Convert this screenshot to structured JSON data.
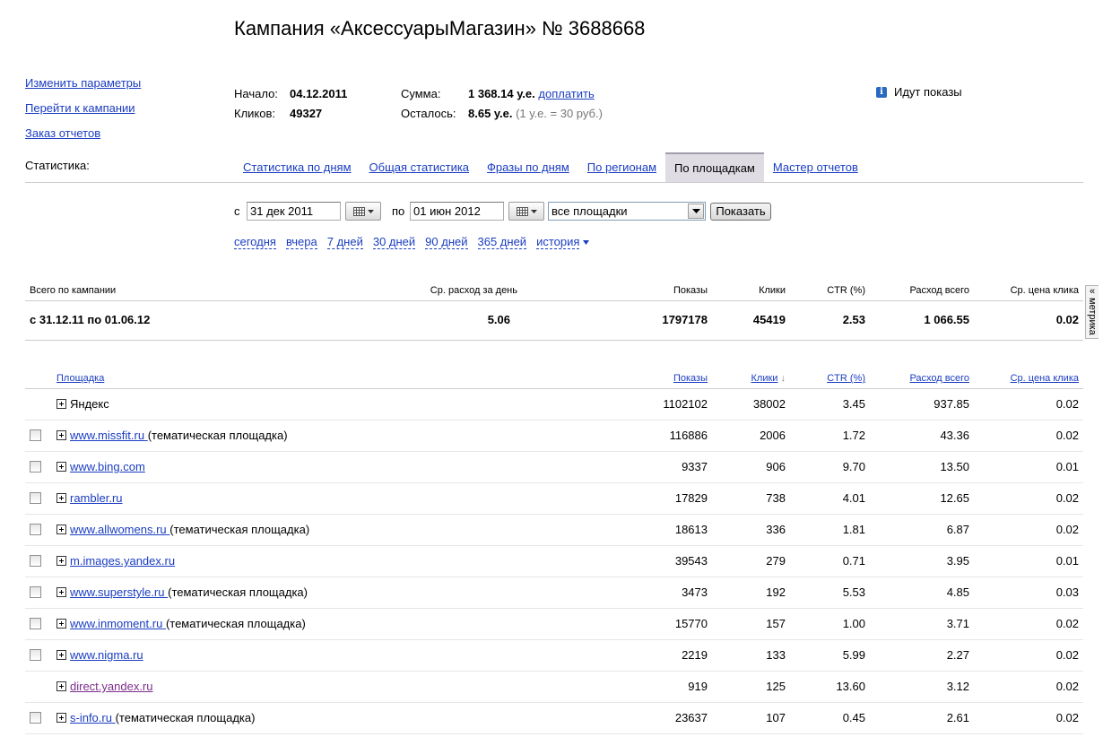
{
  "page": {
    "title": "Кампания «АксессуарыМагазин» № 3688668"
  },
  "colors": {
    "link": "#1a3dc1",
    "visited_link": "#7d2c8c",
    "muted_text": "#777777",
    "active_tab_bg": "#e0dce4",
    "active_tab_border": "#a39dab",
    "info_icon": "#2a69c1"
  },
  "sidebar": {
    "edit_params": "Изменить параметры",
    "go_to_campaign": "Перейти к кампании",
    "order_reports": "Заказ отчетов"
  },
  "info": {
    "start_label": "Начало:",
    "start_value": "04.12.2011",
    "clicks_label": "Кликов:",
    "clicks_value": "49327",
    "sum_label": "Сумма:",
    "sum_value": "1 368.14 у.е.",
    "top_up_link": "доплатить",
    "remaining_label": "Осталось:",
    "remaining_value": "8.65 у.е.",
    "rate_note": "(1 у.е. = 30 руб.)"
  },
  "status": {
    "icon": "info-icon",
    "icon_glyph": "i",
    "text": "Идут показы"
  },
  "stats": {
    "label": "Статистика:",
    "tabs": [
      {
        "label": "Статистика по дням",
        "active": false
      },
      {
        "label": "Общая статистика",
        "active": false
      },
      {
        "label": "Фразы по дням",
        "active": false
      },
      {
        "label": "По регионам",
        "active": false
      },
      {
        "label": "По площадкам",
        "active": true
      },
      {
        "label": "Мастер отчетов",
        "active": false
      }
    ]
  },
  "filter": {
    "from_label": "с",
    "from_value": "31 дек 2011",
    "to_label": "по",
    "to_value": "01 июн 2012",
    "calendar_icon": "calendar-grid-icon",
    "platform_value": "все площадки",
    "submit_label": "Показать",
    "ranges": [
      "сегодня",
      "вчера",
      "7 дней",
      "30 дней",
      "90 дней",
      "365 дней"
    ],
    "history_label": "история"
  },
  "summary": {
    "headers": {
      "total": "Всего по кампании",
      "avg_daily": "Ср. расход за день",
      "shows": "Показы",
      "clicks": "Клики",
      "ctr": "CTR (%)",
      "cost": "Расход всего",
      "cpc": "Ср. цена клика"
    },
    "row": {
      "period": "с 31.12.11 по 01.06.12",
      "avg_daily": "5.06",
      "shows": "1797178",
      "clicks": "45419",
      "ctr": "2.53",
      "cost": "1 066.55",
      "cpc": "0.02"
    }
  },
  "metrika": {
    "label": "метрика",
    "arrow_glyph": "«"
  },
  "table": {
    "headers": {
      "site": "Площадка",
      "shows": "Показы",
      "clicks": "Клики",
      "sort_arrow": "↓",
      "ctr": "CTR (%)",
      "cost": "Расход всего",
      "cpc": "Ср. цена клика"
    },
    "rows": [
      {
        "checkbox": false,
        "is_link": false,
        "visited": false,
        "site": "Яндекс",
        "note": "",
        "shows": "1102102",
        "clicks": "38002",
        "ctr": "3.45",
        "cost": "937.85",
        "cpc": "0.02"
      },
      {
        "checkbox": true,
        "is_link": true,
        "visited": false,
        "site": "www.missfit.ru",
        "note": "(тематическая площадка)",
        "shows": "116886",
        "clicks": "2006",
        "ctr": "1.72",
        "cost": "43.36",
        "cpc": "0.02"
      },
      {
        "checkbox": true,
        "is_link": true,
        "visited": false,
        "site": "www.bing.com",
        "note": "",
        "shows": "9337",
        "clicks": "906",
        "ctr": "9.70",
        "cost": "13.50",
        "cpc": "0.01"
      },
      {
        "checkbox": true,
        "is_link": true,
        "visited": false,
        "site": "rambler.ru",
        "note": "",
        "shows": "17829",
        "clicks": "738",
        "ctr": "4.01",
        "cost": "12.65",
        "cpc": "0.02"
      },
      {
        "checkbox": true,
        "is_link": true,
        "visited": false,
        "site": "www.allwomens.ru",
        "note": "(тематическая площадка)",
        "shows": "18613",
        "clicks": "336",
        "ctr": "1.81",
        "cost": "6.87",
        "cpc": "0.02"
      },
      {
        "checkbox": true,
        "is_link": true,
        "visited": false,
        "site": "m.images.yandex.ru",
        "note": "",
        "shows": "39543",
        "clicks": "279",
        "ctr": "0.71",
        "cost": "3.95",
        "cpc": "0.01"
      },
      {
        "checkbox": true,
        "is_link": true,
        "visited": false,
        "site": "www.superstyle.ru",
        "note": "(тематическая площадка)",
        "shows": "3473",
        "clicks": "192",
        "ctr": "5.53",
        "cost": "4.85",
        "cpc": "0.03"
      },
      {
        "checkbox": true,
        "is_link": true,
        "visited": false,
        "site": "www.inmoment.ru",
        "note": "(тематическая площадка)",
        "shows": "15770",
        "clicks": "157",
        "ctr": "1.00",
        "cost": "3.71",
        "cpc": "0.02"
      },
      {
        "checkbox": true,
        "is_link": true,
        "visited": false,
        "site": "www.nigma.ru",
        "note": "",
        "shows": "2219",
        "clicks": "133",
        "ctr": "5.99",
        "cost": "2.27",
        "cpc": "0.02"
      },
      {
        "checkbox": false,
        "is_link": true,
        "visited": true,
        "site": "direct.yandex.ru",
        "note": "",
        "shows": "919",
        "clicks": "125",
        "ctr": "13.60",
        "cost": "3.12",
        "cpc": "0.02"
      },
      {
        "checkbox": true,
        "is_link": true,
        "visited": false,
        "site": "s-info.ru",
        "note": "(тематическая площадка)",
        "shows": "23637",
        "clicks": "107",
        "ctr": "0.45",
        "cost": "2.61",
        "cpc": "0.02"
      }
    ]
  }
}
